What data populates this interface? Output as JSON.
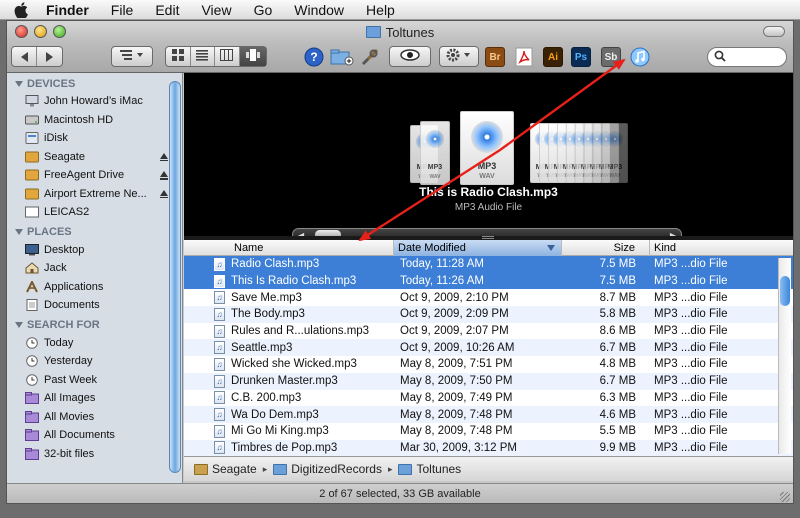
{
  "menubar": {
    "items": [
      "Finder",
      "File",
      "Edit",
      "View",
      "Go",
      "Window",
      "Help"
    ]
  },
  "window": {
    "title": "Toltunes"
  },
  "toolbar": {
    "app_icons": [
      "Br",
      "Ai",
      "Ps",
      "Sb"
    ]
  },
  "sidebar": {
    "devices_heading": "DEVICES",
    "devices": [
      {
        "label": "John Howard’s iMac",
        "icon": "imac-icon",
        "eject": false
      },
      {
        "label": "Macintosh HD",
        "icon": "hard-drive-icon",
        "eject": false
      },
      {
        "label": "iDisk",
        "icon": "idisk-icon",
        "eject": false
      },
      {
        "label": "Seagate",
        "icon": "external-drive-icon",
        "eject": true
      },
      {
        "label": "FreeAgent Drive",
        "icon": "external-drive-icon",
        "eject": true
      },
      {
        "label": "Airport Extreme Ne...",
        "icon": "external-drive-icon",
        "eject": true
      },
      {
        "label": "LEICAS2",
        "icon": "disk-icon",
        "eject": false
      }
    ],
    "places_heading": "PLACES",
    "places": [
      {
        "label": "Desktop",
        "icon": "desktop-icon"
      },
      {
        "label": "Jack",
        "icon": "home-icon"
      },
      {
        "label": "Applications",
        "icon": "applications-icon"
      },
      {
        "label": "Documents",
        "icon": "documents-icon"
      }
    ],
    "search_heading": "SEARCH FOR",
    "searches": [
      {
        "label": "Today",
        "icon": "clock-icon"
      },
      {
        "label": "Yesterday",
        "icon": "clock-icon"
      },
      {
        "label": "Past Week",
        "icon": "clock-icon"
      },
      {
        "label": "All Images",
        "icon": "smart-folder-icon"
      },
      {
        "label": "All Movies",
        "icon": "smart-folder-icon"
      },
      {
        "label": "All Documents",
        "icon": "smart-folder-icon"
      },
      {
        "label": "32-bit files",
        "icon": "smart-folder-icon"
      }
    ]
  },
  "preview": {
    "card_label": "MP3",
    "card_sublabel": "WAV",
    "title": "This is Radio Clash.mp3",
    "subtitle": "MP3 Audio File"
  },
  "list": {
    "columns": {
      "name": "Name",
      "date": "Date Modified",
      "size": "Size",
      "kind": "Kind"
    },
    "rows": [
      {
        "name": "Radio Clash.mp3",
        "date": "Today, 11:28 AM",
        "size": "7.5 MB",
        "kind": "MP3 ...dio File",
        "selected": true
      },
      {
        "name": "This Is Radio Clash.mp3",
        "date": "Today, 11:26 AM",
        "size": "7.5 MB",
        "kind": "MP3 ...dio File",
        "selected": true
      },
      {
        "name": "Save Me.mp3",
        "date": "Oct 9, 2009, 2:10 PM",
        "size": "8.7 MB",
        "kind": "MP3 ...dio File",
        "selected": false
      },
      {
        "name": "The Body.mp3",
        "date": "Oct 9, 2009, 2:09 PM",
        "size": "5.8 MB",
        "kind": "MP3 ...dio File",
        "selected": false
      },
      {
        "name": "Rules and R...ulations.mp3",
        "date": "Oct 9, 2009, 2:07 PM",
        "size": "8.6 MB",
        "kind": "MP3 ...dio File",
        "selected": false
      },
      {
        "name": "Seattle.mp3",
        "date": "Oct 9, 2009, 10:26 AM",
        "size": "6.7 MB",
        "kind": "MP3 ...dio File",
        "selected": false
      },
      {
        "name": "Wicked she Wicked.mp3",
        "date": "May 8, 2009, 7:51 PM",
        "size": "4.8 MB",
        "kind": "MP3 ...dio File",
        "selected": false
      },
      {
        "name": "Drunken Master.mp3",
        "date": "May 8, 2009, 7:50 PM",
        "size": "6.7 MB",
        "kind": "MP3 ...dio File",
        "selected": false
      },
      {
        "name": "C.B. 200.mp3",
        "date": "May 8, 2009, 7:49 PM",
        "size": "6.3 MB",
        "kind": "MP3 ...dio File",
        "selected": false
      },
      {
        "name": "Wa Do Dem.mp3",
        "date": "May 8, 2009, 7:48 PM",
        "size": "4.6 MB",
        "kind": "MP3 ...dio File",
        "selected": false
      },
      {
        "name": "Mi Go Mi King.mp3",
        "date": "May 8, 2009, 7:48 PM",
        "size": "5.5 MB",
        "kind": "MP3 ...dio File",
        "selected": false
      },
      {
        "name": "Timbres de Pop.mp3",
        "date": "Mar 30, 2009, 3:12 PM",
        "size": "9.9 MB",
        "kind": "MP3 ...dio File",
        "selected": false
      }
    ]
  },
  "pathbar": {
    "crumbs": [
      "Seagate",
      "DigitizedRecords",
      "Toltunes"
    ]
  },
  "status": {
    "text": "2 of 67 selected, 33 GB available"
  },
  "colors": {
    "selection": "#3d7fd6",
    "annotation_arrow": "#e8201a",
    "sidebar_bg": "#d6dde5"
  }
}
